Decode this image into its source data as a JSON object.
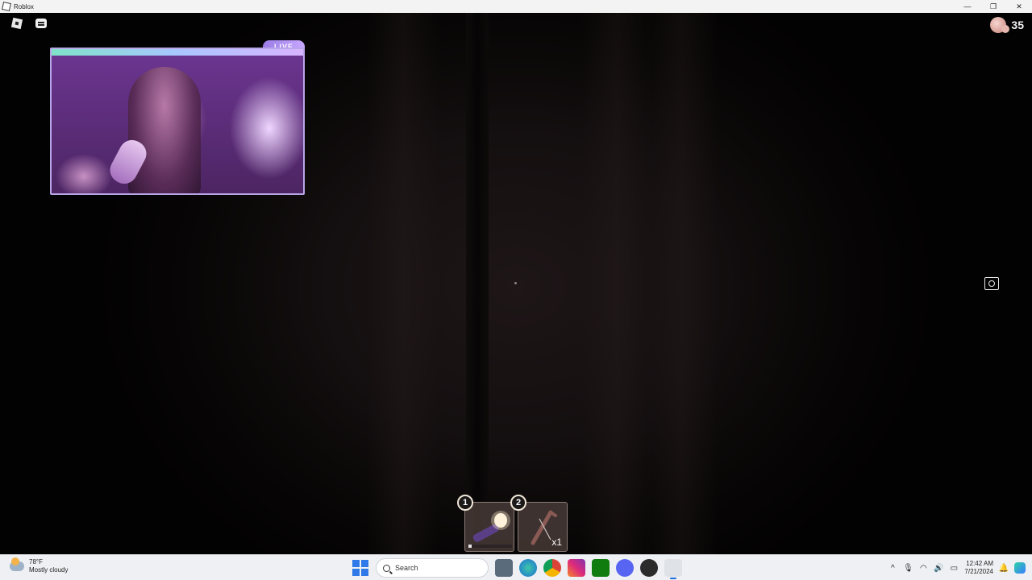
{
  "window": {
    "title": "Roblox",
    "controls": [
      "—",
      "❐",
      "✕"
    ]
  },
  "hud": {
    "player_count": "35",
    "stream_badge": "LIVE"
  },
  "hotbar": [
    {
      "slot": "1",
      "item": "flashlight",
      "qty": "",
      "charge_fraction": 0.08
    },
    {
      "slot": "2",
      "item": "crowbar",
      "qty": "x1"
    }
  ],
  "taskbar": {
    "weather_temp": "78°F",
    "weather_desc": "Mostly cloudy",
    "search_placeholder": "Search",
    "time": "12:42 AM",
    "date": "7/21/2024",
    "apps": [
      "file-explorer-icon",
      "edge-icon",
      "chrome-icon",
      "instagram-icon",
      "xbox-icon",
      "discord-icon",
      "obs-icon",
      "roblox-icon"
    ]
  },
  "colors": {
    "stream_frame": "#b9a6e8",
    "taskbar_bg": "#eef0f3",
    "accent_blue": "#2f79e8"
  }
}
